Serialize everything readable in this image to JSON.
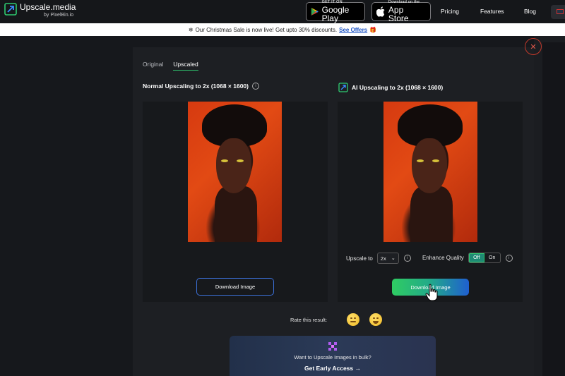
{
  "brand": {
    "name": "Upscale.media",
    "by": "by PixelBin.io"
  },
  "stores": {
    "google": {
      "small": "GET IT ON",
      "big": "Google Play"
    },
    "apple": {
      "small": "Download on the",
      "big": "App Store"
    }
  },
  "nav": {
    "links": [
      "Pricing",
      "Features",
      "Blog"
    ]
  },
  "banner": {
    "text": "Our Christmas Sale is now live! Get upto 30% discounts.",
    "link": "See Offers"
  },
  "tabs": [
    {
      "label": "Original",
      "active": false
    },
    {
      "label": "Upscaled",
      "active": true
    }
  ],
  "left_panel": {
    "title": "Normal Upscaling to 2x (1068 × 1600)",
    "button": "Download Image"
  },
  "right_panel": {
    "title": "AI Upscaling to 2x (1068 × 1600)",
    "upscale_label": "Upscale to",
    "upscale_value": "2x",
    "enhance_label": "Enhance Quality",
    "toggle_off": "Off",
    "toggle_on": "On",
    "button": "Download Image"
  },
  "rate": {
    "label": "Rate this result:"
  },
  "bulk": {
    "text": "Want to Upscale Images in bulk?",
    "cta": "Get Early Access →"
  },
  "colors": {
    "accent_green": "#2ecc71",
    "accent_blue": "#1f5fd0",
    "close_red": "#c0392b"
  }
}
